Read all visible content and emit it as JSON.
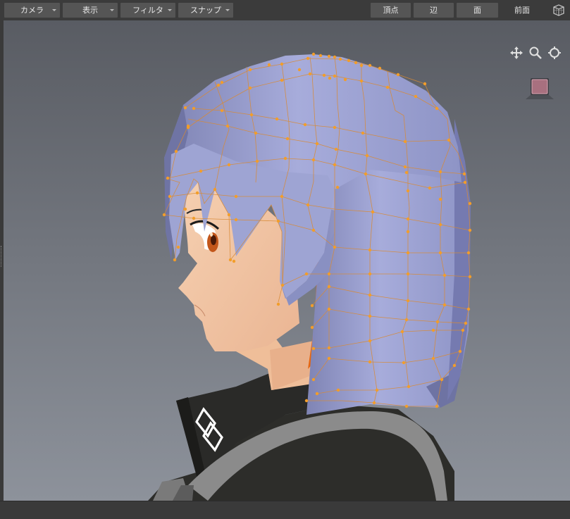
{
  "toolbar": {
    "camera": "カメラ",
    "display": "表示",
    "filter": "フィルタ",
    "snap": "スナップ",
    "vertex": "頂点",
    "edge": "辺",
    "face": "面",
    "view": "前面"
  },
  "viewport": {
    "tools": [
      "move-icon",
      "zoom-icon",
      "orbit-icon"
    ],
    "colors": {
      "background_top": "#5a5d64",
      "background_bottom": "#8a8f98",
      "hair": "#a2a8d6",
      "wire": "#e08a2a",
      "vertex": "#f0a030",
      "skin": "#f3c9a6",
      "jacket": "#2f2f2c",
      "inner_hair": "#e86a10"
    }
  }
}
